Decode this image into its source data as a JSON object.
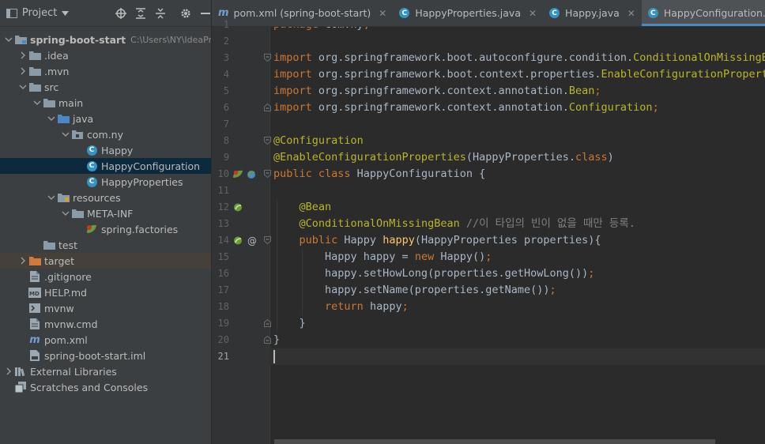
{
  "project_panel": {
    "title": "Project",
    "tree": [
      {
        "label": "spring-boot-start",
        "path": "C:\\Users\\NY\\IdeaPro",
        "icon": "module-folder-icon",
        "level": 0,
        "expanded": true
      },
      {
        "label": ".idea",
        "icon": "folder-icon",
        "level": 1,
        "expanded": false
      },
      {
        "label": ".mvn",
        "icon": "folder-icon",
        "level": 1,
        "expanded": false
      },
      {
        "label": "src",
        "icon": "folder-icon",
        "level": 1,
        "expanded": true
      },
      {
        "label": "main",
        "icon": "folder-icon",
        "level": 2,
        "expanded": true
      },
      {
        "label": "java",
        "icon": "source-folder-icon",
        "level": 3,
        "expanded": true
      },
      {
        "label": "com.ny",
        "icon": "package-icon",
        "level": 4,
        "expanded": true
      },
      {
        "label": "Happy",
        "icon": "class-icon",
        "level": 5
      },
      {
        "label": "HappyConfiguration",
        "icon": "class-icon",
        "level": 5,
        "selected": true
      },
      {
        "label": "HappyProperties",
        "icon": "class-icon",
        "level": 5
      },
      {
        "label": "resources",
        "icon": "resources-folder-icon",
        "level": 3,
        "expanded": true
      },
      {
        "label": "META-INF",
        "icon": "folder-icon",
        "level": 4,
        "expanded": true
      },
      {
        "label": "spring.factories",
        "icon": "spring-file-icon",
        "level": 5
      },
      {
        "label": "test",
        "icon": "folder-icon",
        "level": 2
      },
      {
        "label": "target",
        "icon": "excluded-folder-icon",
        "level": 1,
        "expanded": false
      },
      {
        "label": ".gitignore",
        "icon": "text-file-icon",
        "level": 1
      },
      {
        "label": "HELP.md",
        "icon": "markdown-file-icon",
        "level": 1
      },
      {
        "label": "mvnw",
        "icon": "script-file-icon",
        "level": 1
      },
      {
        "label": "mvnw.cmd",
        "icon": "text-file-icon",
        "level": 1
      },
      {
        "label": "pom.xml",
        "icon": "maven-icon",
        "level": 1
      },
      {
        "label": "spring-boot-start.iml",
        "icon": "iml-file-icon",
        "level": 1
      },
      {
        "label": "External Libraries",
        "icon": "library-icon",
        "level": 0,
        "expanded": false
      },
      {
        "label": "Scratches and Consoles",
        "icon": "scratches-icon",
        "level": 0
      }
    ]
  },
  "tabs": [
    {
      "label": "pom.xml (spring-boot-start)",
      "icon": "maven-icon",
      "active": false
    },
    {
      "label": "HappyProperties.java",
      "icon": "class-icon",
      "active": false
    },
    {
      "label": "Happy.java",
      "icon": "class-icon",
      "active": false
    },
    {
      "label": "HappyConfiguration.java",
      "icon": "class-icon",
      "active": true
    }
  ],
  "editor": {
    "current_line": 21,
    "lines": [
      {
        "n": "1",
        "t": [
          [
            "kw",
            "package "
          ],
          [
            "",
            "com.ny"
          ],
          [
            "kw",
            ";"
          ]
        ]
      },
      {
        "n": "2",
        "t": []
      },
      {
        "n": "3",
        "t": [
          [
            "kw",
            "import "
          ],
          [
            "",
            "org.springframework.boot.autoconfigure.condition."
          ],
          [
            "ann",
            "ConditionalOnMissingBean"
          ],
          [
            "kw",
            ";"
          ]
        ]
      },
      {
        "n": "4",
        "t": [
          [
            "kw",
            "import "
          ],
          [
            "",
            "org.springframework.boot.context.properties."
          ],
          [
            "ann",
            "EnableConfigurationProperties"
          ],
          [
            "kw",
            ";"
          ]
        ]
      },
      {
        "n": "5",
        "t": [
          [
            "kw",
            "import "
          ],
          [
            "",
            "org.springframework.context.annotation."
          ],
          [
            "ann",
            "Bean"
          ],
          [
            "kw",
            ";"
          ]
        ]
      },
      {
        "n": "6",
        "t": [
          [
            "kw",
            "import "
          ],
          [
            "",
            "org.springframework.context.annotation."
          ],
          [
            "ann",
            "Configuration"
          ],
          [
            "kw",
            ";"
          ]
        ]
      },
      {
        "n": "7",
        "t": []
      },
      {
        "n": "8",
        "t": [
          [
            "ann",
            "@Configuration"
          ]
        ]
      },
      {
        "n": "9",
        "t": [
          [
            "ann",
            "@EnableConfigurationProperties"
          ],
          [
            "",
            "(HappyProperties."
          ],
          [
            "kw",
            "class"
          ],
          [
            "",
            ")"
          ]
        ]
      },
      {
        "n": "10",
        "t": [
          [
            "kw",
            "public class "
          ],
          [
            "",
            "HappyConfiguration {"
          ]
        ]
      },
      {
        "n": "11",
        "t": []
      },
      {
        "n": "12",
        "t": [
          [
            "",
            "    "
          ],
          [
            "ann",
            "@Bean"
          ]
        ]
      },
      {
        "n": "13",
        "t": [
          [
            "",
            "    "
          ],
          [
            "ann",
            "@ConditionalOnMissingBean "
          ],
          [
            "cm",
            "//이 타입의 빈이 없을 때만 등록."
          ]
        ]
      },
      {
        "n": "14",
        "t": [
          [
            "",
            "    "
          ],
          [
            "kw",
            "public "
          ],
          [
            "",
            "Happy "
          ],
          [
            "fn",
            "happy"
          ],
          [
            "",
            "(HappyProperties properties){"
          ]
        ]
      },
      {
        "n": "15",
        "t": [
          [
            "",
            "        Happy happy = "
          ],
          [
            "kw",
            "new "
          ],
          [
            "",
            "Happy()"
          ],
          [
            "kw",
            ";"
          ]
        ]
      },
      {
        "n": "16",
        "t": [
          [
            "",
            "        happy.setHowLong(properties.getHowLong())"
          ],
          [
            "kw",
            ";"
          ]
        ]
      },
      {
        "n": "17",
        "t": [
          [
            "",
            "        happy.setName(properties.getName())"
          ],
          [
            "kw",
            ";"
          ]
        ]
      },
      {
        "n": "18",
        "t": [
          [
            "",
            "        "
          ],
          [
            "kw",
            "return "
          ],
          [
            "",
            "happy"
          ],
          [
            "kw",
            ";"
          ]
        ]
      },
      {
        "n": "19",
        "t": [
          [
            "",
            "    }"
          ]
        ]
      },
      {
        "n": "20",
        "t": [
          [
            "",
            "}"
          ]
        ]
      },
      {
        "n": "21",
        "t": []
      }
    ]
  },
  "colors": {
    "keyword": "#cc7832",
    "annotation": "#bbb529",
    "method": "#ffc66d",
    "comment": "#808080",
    "text": "#a9b7c6",
    "selection": "#0d293e",
    "tab_underline": "#4a88c7"
  }
}
